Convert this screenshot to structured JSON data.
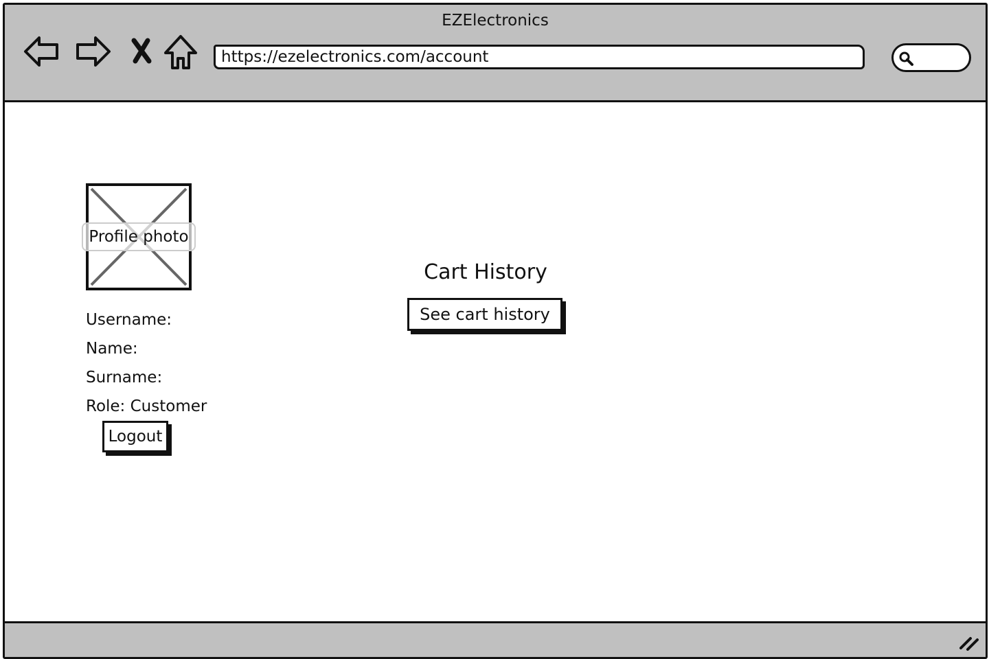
{
  "window": {
    "title": "EZElectronics"
  },
  "toolbar": {
    "url": "https://ezelectronics.com/account",
    "icons": [
      "back-arrow-icon",
      "forward-arrow-icon",
      "stop-icon",
      "home-icon",
      "search-icon"
    ]
  },
  "profile": {
    "photo_label": "Profile photo",
    "username_label": "Username:",
    "name_label": "Name:",
    "surname_label": "Surname:",
    "role_label": "Role: Customer",
    "logout_label": "Logout"
  },
  "cart": {
    "title": "Cart History",
    "button_label": "See cart history"
  },
  "colors": {
    "chrome": "#c0c0c0",
    "outline": "#111111",
    "background": "#ffffff"
  }
}
